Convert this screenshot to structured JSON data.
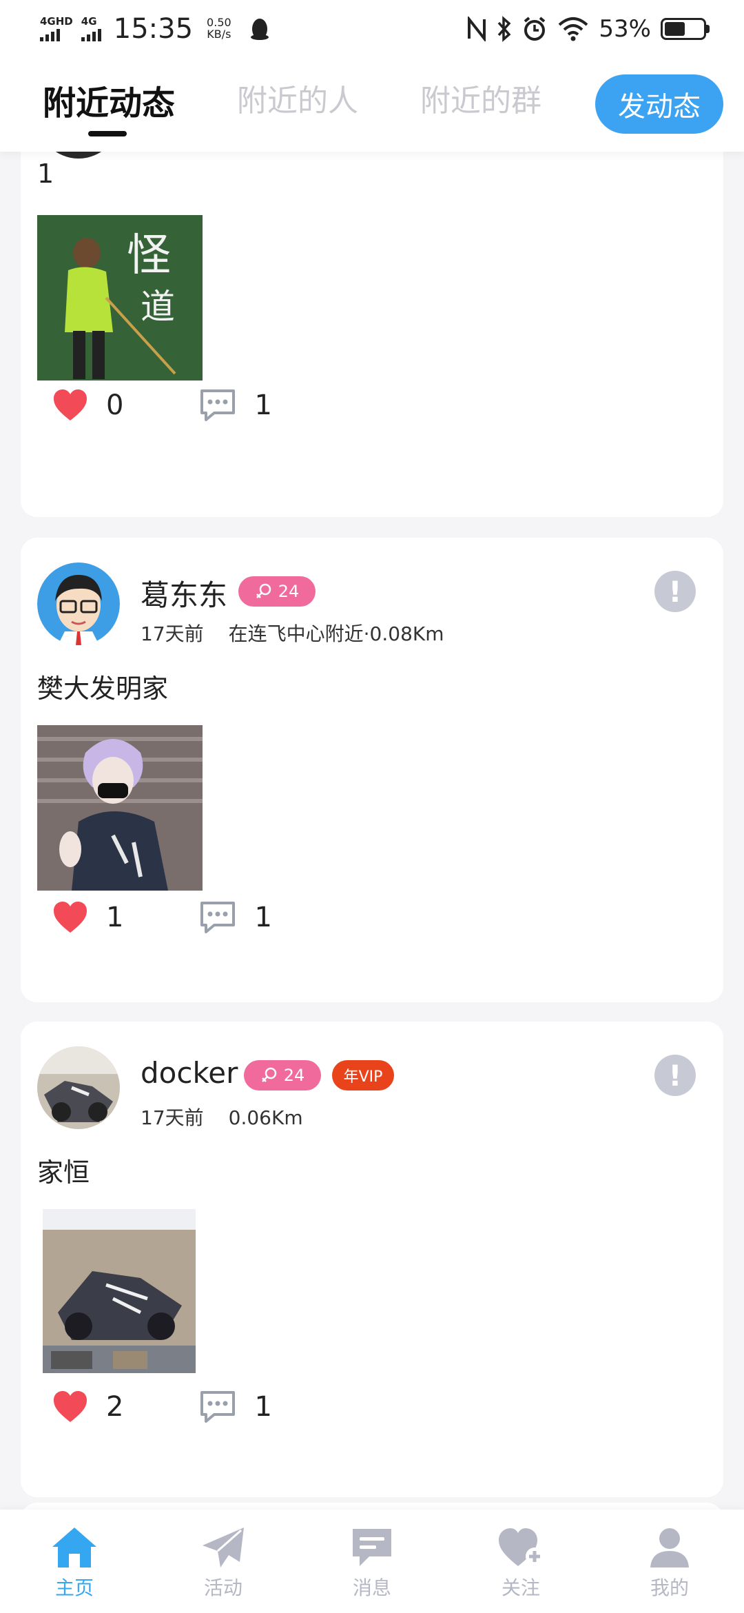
{
  "status_bar": {
    "network_1": "4GHD",
    "network_2": "4G",
    "time": "15:35",
    "speed_value": "0.50",
    "speed_unit": "KB/s",
    "battery": "53%",
    "battery_level": 0.53
  },
  "top_nav": {
    "tabs": [
      {
        "label": "附近动态",
        "active": true
      },
      {
        "label": "附近的人",
        "active": false
      },
      {
        "label": "附近的群",
        "active": false
      }
    ],
    "post_button": "发动态"
  },
  "posts": [
    {
      "content": "1",
      "likes": "0",
      "comments": "1"
    },
    {
      "name": "葛东东",
      "age": "24",
      "time": "17天前",
      "location": "在连飞中心附近·0.08Km",
      "content": "樊大发明家",
      "likes": "1",
      "comments": "1"
    },
    {
      "name": "docker",
      "age": "24",
      "vip": "年VIP",
      "time": "17天前",
      "location": "0.06Km",
      "content": "家恒",
      "likes": "2",
      "comments": "1"
    }
  ],
  "bottom_nav": [
    {
      "label": "主页",
      "icon": "home-icon",
      "active": true
    },
    {
      "label": "活动",
      "icon": "paper-plane-icon",
      "active": false
    },
    {
      "label": "消息",
      "icon": "message-icon",
      "active": false
    },
    {
      "label": "关注",
      "icon": "heart-plus-icon",
      "active": false
    },
    {
      "label": "我的",
      "icon": "person-icon",
      "active": false
    }
  ],
  "colors": {
    "accent": "#3ba3f2",
    "like": "#f24a57",
    "female_badge": "#f06a9b",
    "vip_badge": "#e8431a",
    "inactive_nav": "#b5b8c4"
  }
}
